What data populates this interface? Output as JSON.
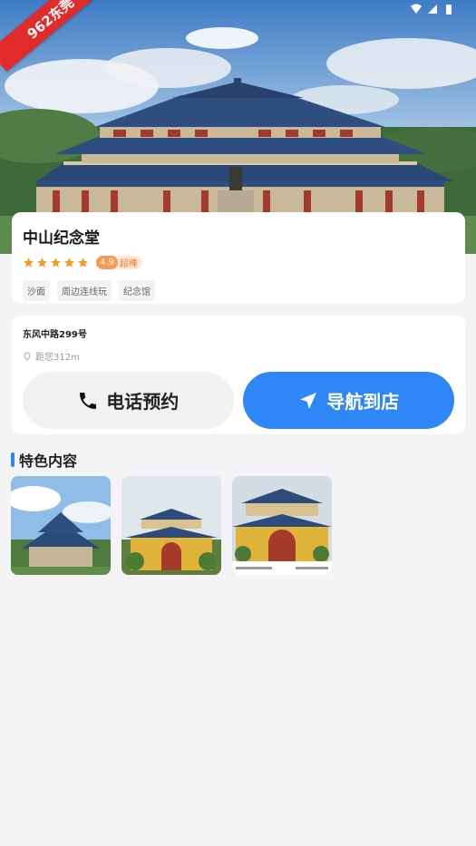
{
  "status_bar": {
    "icons": [
      "wifi-icon",
      "signal-icon",
      "battery-icon"
    ]
  },
  "watermark": {
    "text": "962东莞"
  },
  "place": {
    "name": "中山纪念堂",
    "stars": 5,
    "score": "4.9",
    "score_label": "超棒",
    "tags": [
      "沙面",
      "周边连线玩",
      "纪念馆"
    ]
  },
  "location": {
    "address": "东风中路299号",
    "distance": "距您312m"
  },
  "actions": {
    "call_label": "电话预约",
    "navigate_label": "导航到店"
  },
  "featured": {
    "title": "特色内容",
    "items": [
      "featured-photo-1",
      "featured-photo-2",
      "featured-photo-3"
    ]
  },
  "colors": {
    "accent": "#2e86f7",
    "star": "#f59a23",
    "badge": "#f59a52",
    "ribbon": "#e12a2a"
  }
}
